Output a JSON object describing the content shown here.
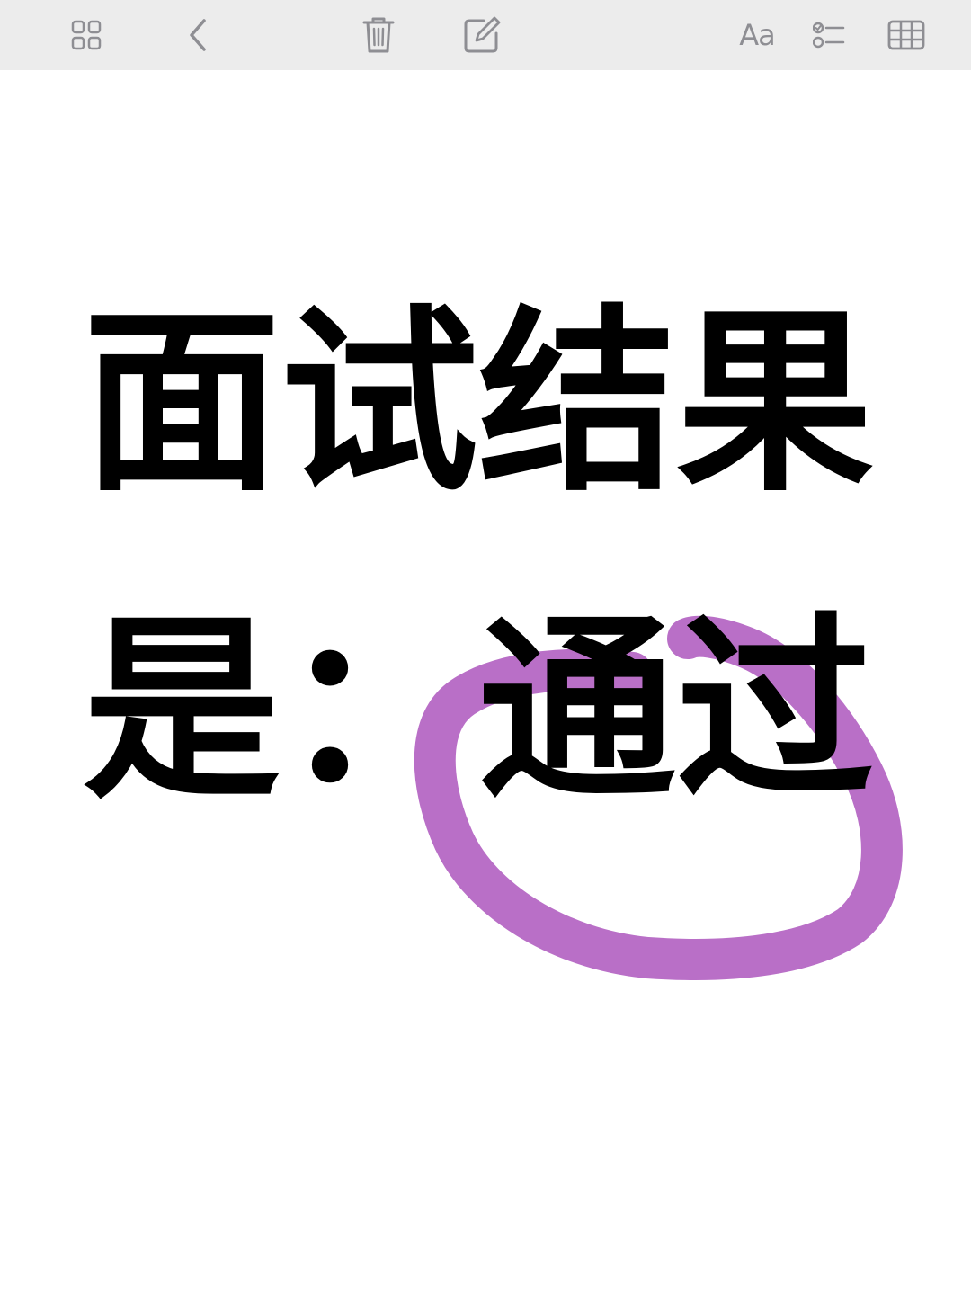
{
  "toolbar": {
    "buttons": [
      {
        "name": "gallery-view",
        "icon": "grid-icon"
      },
      {
        "name": "back",
        "icon": "chevron-left-icon"
      },
      {
        "name": "delete",
        "icon": "trash-icon"
      },
      {
        "name": "compose",
        "icon": "compose-icon"
      },
      {
        "name": "text-format",
        "icon": "text-format-icon",
        "label": "Aa"
      },
      {
        "name": "checklist",
        "icon": "checklist-icon"
      },
      {
        "name": "table",
        "icon": "table-icon"
      }
    ],
    "icon_color": "#8e8e93",
    "background": "#ececec"
  },
  "note": {
    "line1": "面试结果",
    "line2_prefix": "是：",
    "line2_highlight": "通过",
    "text_color": "#000000",
    "highlight_circle_color": "#b96fc7"
  }
}
